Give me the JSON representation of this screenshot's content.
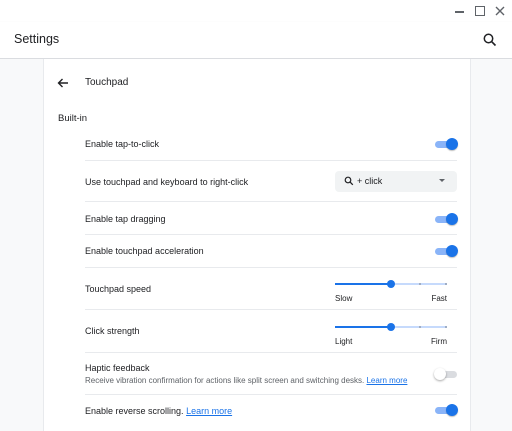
{
  "app": {
    "title": "Settings"
  },
  "page": {
    "title": "Touchpad",
    "section": "Built-in"
  },
  "rows": {
    "tap_to_click": {
      "label": "Enable tap-to-click",
      "enabled": true
    },
    "right_click": {
      "label": "Use touchpad and keyboard to right-click",
      "selected_value": "+ click",
      "icon": "search-icon"
    },
    "tap_dragging": {
      "label": "Enable tap dragging",
      "enabled": true
    },
    "acceleration": {
      "label": "Enable touchpad acceleration",
      "enabled": true
    },
    "speed": {
      "label": "Touchpad speed",
      "min_label": "Slow",
      "max_label": "Fast",
      "level": 3,
      "max_level": 5
    },
    "click_strength": {
      "label": "Click strength",
      "min_label": "Light",
      "max_label": "Firm",
      "level": 3,
      "max_level": 5
    },
    "haptic": {
      "label": "Haptic feedback",
      "sublabel": "Receive vibration confirmation for actions like split screen and switching desks.",
      "link": "Learn more",
      "enabled": false
    },
    "reverse_scroll": {
      "label": "Enable reverse scrolling.",
      "link": "Learn more",
      "enabled": true
    }
  },
  "colors": {
    "accent": "#1a73e8",
    "accent_light": "#8ab4f8",
    "divider": "#e8eaed",
    "text": "#202124",
    "secondary_text": "#5f6368"
  }
}
